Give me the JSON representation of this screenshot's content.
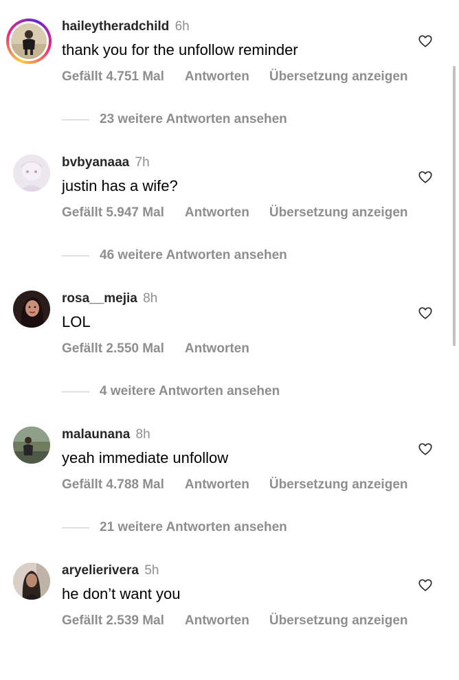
{
  "comments": [
    {
      "username": "haileytheradchild",
      "time": "6h",
      "text": "thank you for the unfollow reminder",
      "likes": "Gefällt 4.751 Mal",
      "reply": "Antworten",
      "translate": "Übersetzung anzeigen",
      "more_replies": "23 weitere Antworten ansehen"
    },
    {
      "username": "bvbyanaaa",
      "time": "7h",
      "text": "justin has a wife?",
      "likes": "Gefällt 5.947 Mal",
      "reply": "Antworten",
      "translate": "Übersetzung anzeigen",
      "more_replies": "46 weitere Antworten ansehen"
    },
    {
      "username": "rosa__mejia",
      "time": "8h",
      "text": "LOL",
      "likes": "Gefällt 2.550 Mal",
      "reply": "Antworten",
      "more_replies": "4 weitere Antworten ansehen"
    },
    {
      "username": "malaunana",
      "time": "8h",
      "text": "yeah immediate unfollow",
      "likes": "Gefällt 4.788 Mal",
      "reply": "Antworten",
      "translate": "Übersetzung anzeigen",
      "more_replies": "21 weitere Antworten ansehen"
    },
    {
      "username": "aryelierivera",
      "time": "5h",
      "text": "he don’t want you",
      "likes": "Gefällt 2.539 Mal",
      "reply": "Antworten",
      "translate": "Übersetzung anzeigen"
    }
  ],
  "icons": {
    "like": "heart-outline-icon"
  },
  "colors": {
    "secondary_text": "#8e8e8e",
    "story_ring_start": "#f9ce34",
    "story_ring_mid": "#ee2a7b",
    "story_ring_end": "#6228d7"
  }
}
